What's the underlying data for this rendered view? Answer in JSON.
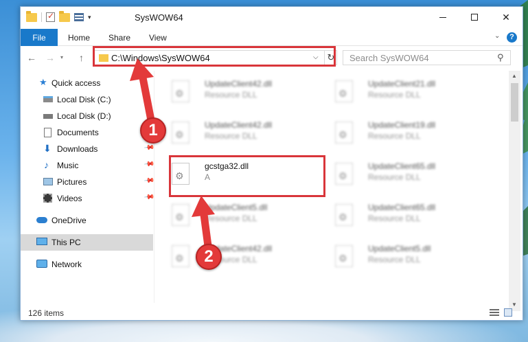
{
  "window": {
    "title": "SysWOW64",
    "minimize_label": "",
    "maximize_label": "",
    "close_label": "✕"
  },
  "ribbon": {
    "tabs": [
      "File",
      "Home",
      "Share",
      "View"
    ],
    "help": "?"
  },
  "navigation": {
    "back": "←",
    "forward": "→",
    "recent": "▾",
    "up": "↑",
    "address": "C:\\Windows\\SysWOW64",
    "address_dropdown": "⌵",
    "refresh": "↻",
    "search_placeholder": "Search SysWOW64",
    "search_icon": "⚲"
  },
  "sidebar": {
    "items": [
      {
        "label": "Quick access",
        "icon": "star-icon",
        "pinned": false
      },
      {
        "label": "Local Disk (C:)",
        "icon": "drive-icon",
        "pinned": false
      },
      {
        "label": "Local Disk (D:)",
        "icon": "drive-icon",
        "pinned": false
      },
      {
        "label": "Documents",
        "icon": "documents-icon",
        "pinned": false
      },
      {
        "label": "Downloads",
        "icon": "downloads-icon",
        "pinned": true
      },
      {
        "label": "Music",
        "icon": "music-icon",
        "pinned": true
      },
      {
        "label": "Pictures",
        "icon": "pictures-icon",
        "pinned": true
      },
      {
        "label": "Videos",
        "icon": "videos-icon",
        "pinned": true
      },
      {
        "label": "OneDrive",
        "icon": "cloud-icon",
        "pinned": false
      },
      {
        "label": "This PC",
        "icon": "computer-icon",
        "pinned": false,
        "selected": true
      },
      {
        "label": "Network",
        "icon": "network-icon",
        "pinned": false
      }
    ],
    "pin_glyph": "📌"
  },
  "files": [
    {
      "name": "UpdateClient42.dll",
      "type": "Resource DLL"
    },
    {
      "name": "UpdateClient21.dll",
      "type": "Resource DLL"
    },
    {
      "name": "UpdateClient42.dll",
      "type": "Resource DLL"
    },
    {
      "name": "UpdateClient19.dll",
      "type": "Resource DLL"
    },
    {
      "name": "gcstga32.dll",
      "type": "A",
      "selected": true
    },
    {
      "name": "UpdateClient65.dll",
      "type": "Resource DLL"
    },
    {
      "name": "UpdateClient5.dll",
      "type": "Resource DLL"
    },
    {
      "name": "UpdateClient65.dll",
      "type": "Resource DLL"
    },
    {
      "name": "UpdateClient42.dll",
      "type": "Resource DLL"
    },
    {
      "name": "UpdateClient5.dll",
      "type": "Resource DLL"
    }
  ],
  "status": {
    "item_count": "126 items"
  },
  "annotations": {
    "callout_1": "1",
    "callout_2": "2",
    "color": "#e33a3a"
  },
  "scrollbar": {
    "up": "▲",
    "down": "▼"
  }
}
